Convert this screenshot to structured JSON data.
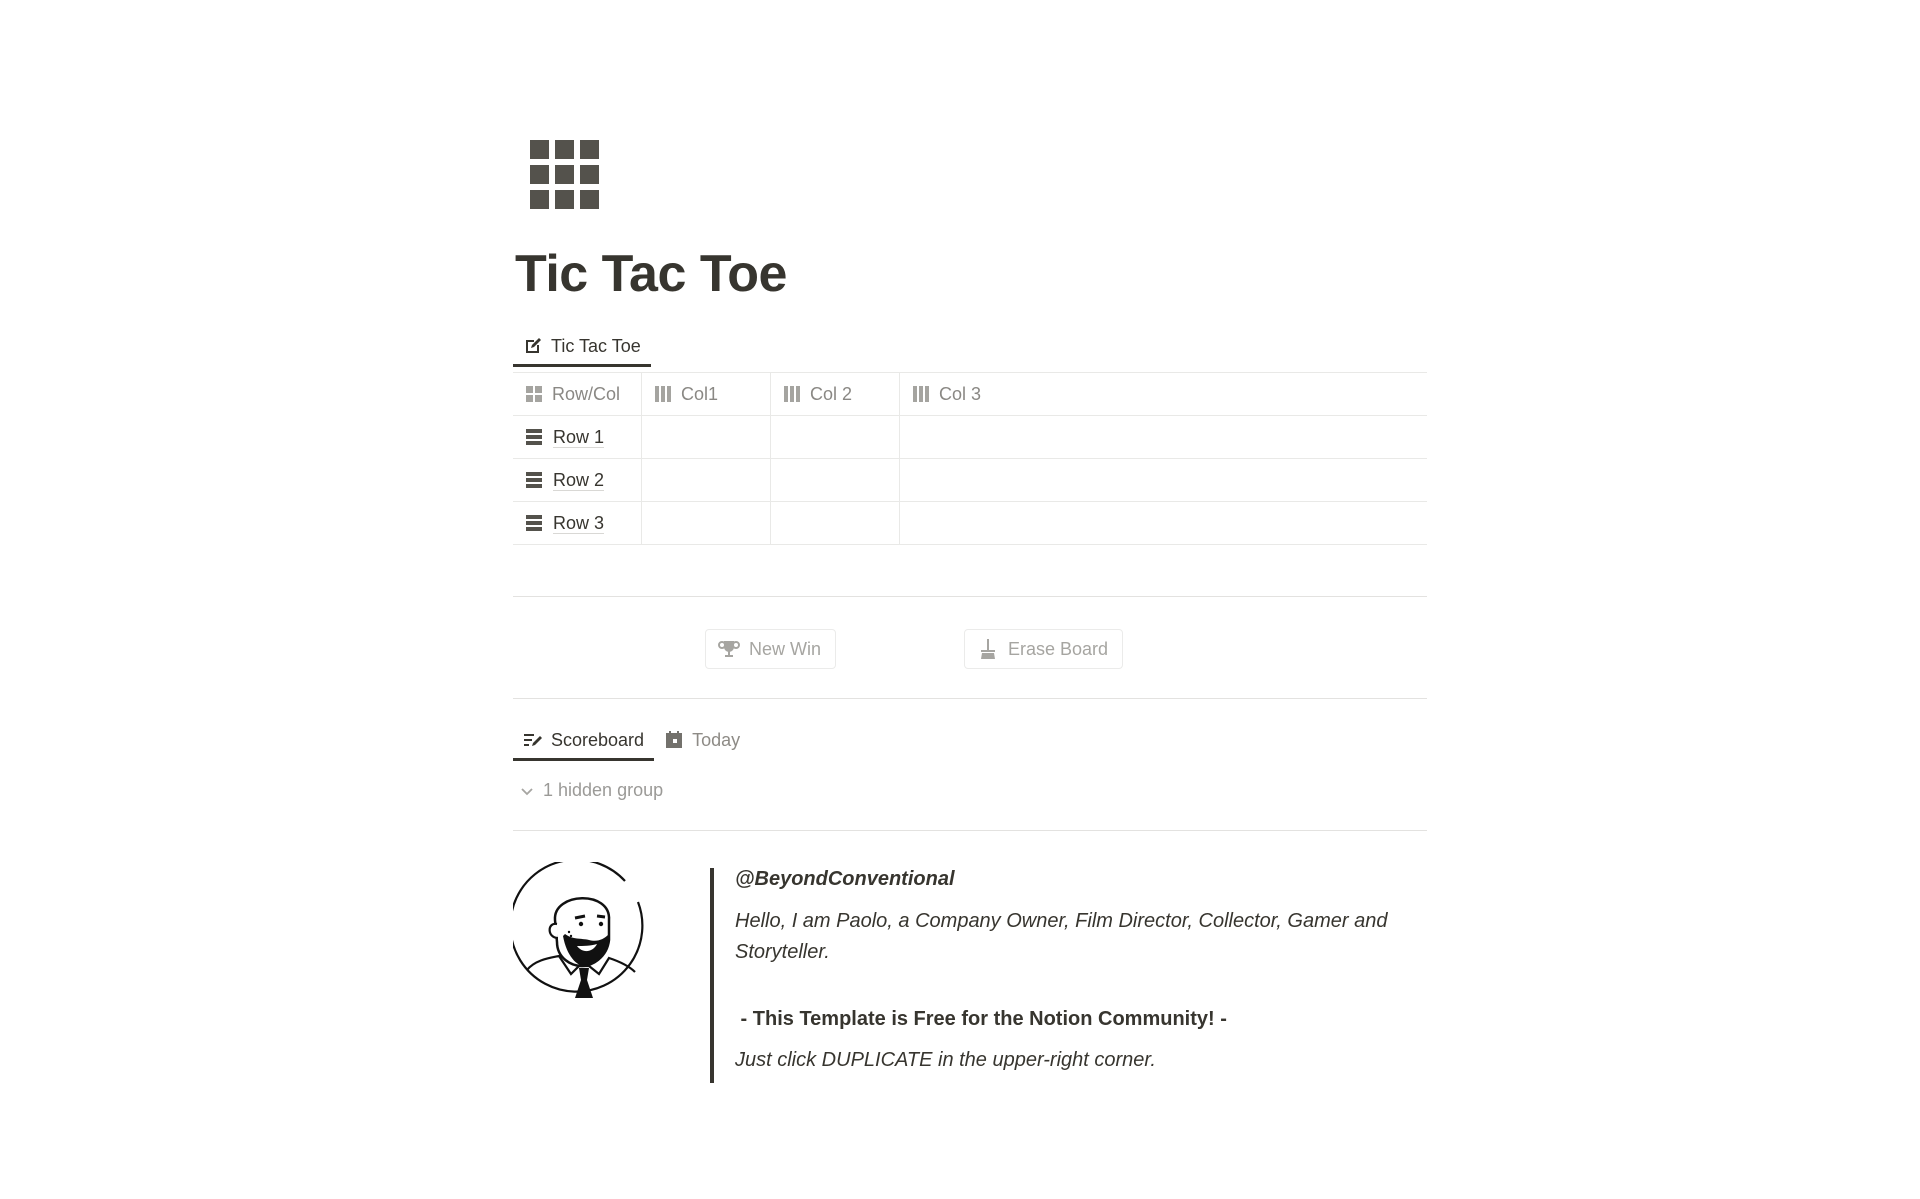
{
  "page": {
    "icon": "grid-3x3-icon",
    "title": "Tic Tac Toe"
  },
  "board_view": {
    "tabs": [
      {
        "label": "Tic Tac Toe",
        "icon": "edit-icon",
        "active": true
      }
    ],
    "columns": [
      {
        "label": "Row/Col",
        "icon": "grid-icon"
      },
      {
        "label": "Col1",
        "icon": "columns-icon"
      },
      {
        "label": "Col 2",
        "icon": "columns-icon"
      },
      {
        "label": "Col 3",
        "icon": "columns-icon"
      }
    ],
    "rows": [
      {
        "label": "Row 1",
        "icon": "rows-icon",
        "cells": [
          "",
          "",
          ""
        ]
      },
      {
        "label": "Row 2",
        "icon": "rows-icon",
        "cells": [
          "",
          "",
          ""
        ]
      },
      {
        "label": "Row 3",
        "icon": "rows-icon",
        "cells": [
          "",
          "",
          ""
        ]
      }
    ]
  },
  "buttons": {
    "new_win": {
      "label": "New Win",
      "icon": "trophy-icon"
    },
    "erase_board": {
      "label": "Erase Board",
      "icon": "broom-icon"
    }
  },
  "scoreboard_view": {
    "tabs": [
      {
        "label": "Scoreboard",
        "icon": "list-edit-icon",
        "active": true
      },
      {
        "label": "Today",
        "icon": "calendar-icon",
        "active": false
      }
    ],
    "hidden_group_label": "1 hidden group"
  },
  "author": {
    "avatar": "bearded-man-portrait",
    "handle": "@BeyondConventional",
    "bio": "Hello, I am Paolo, a Company Owner, Film Director, Collector, Gamer and Storyteller.",
    "free_note": " - This Template is Free for the Notion Community! -",
    "duplicate_note": "Just click DUPLICATE in the upper-right corner."
  },
  "colors": {
    "text": "#37352f",
    "muted": "#9b9a97",
    "border": "#e9e9e7",
    "icon_dark": "#54524c"
  }
}
